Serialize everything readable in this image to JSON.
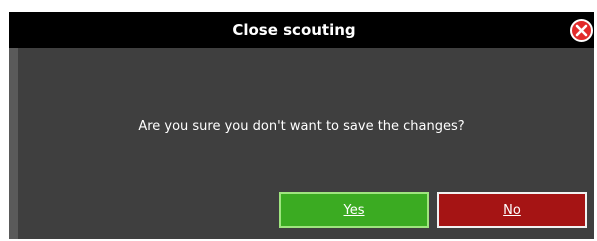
{
  "dialog": {
    "title": "Close scouting",
    "message": "Are you sure you don't want to save the changes?",
    "yes_label": "Yes",
    "no_label": "No"
  },
  "icons": {
    "close": "close-icon"
  },
  "colors": {
    "background": "#3f3f3f",
    "titlebar": "#000000",
    "yes": "#3bab22",
    "no": "#a51414",
    "close": "#e22b2b"
  }
}
